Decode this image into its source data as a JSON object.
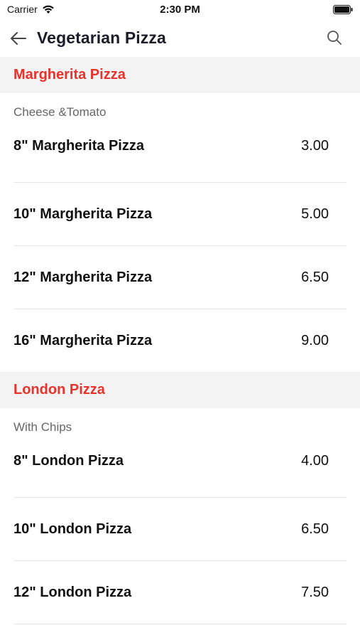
{
  "status": {
    "carrier": "Carrier",
    "time": "2:30 PM"
  },
  "nav": {
    "title": "Vegetarian Pizza"
  },
  "sections": [
    {
      "title": "Margherita Pizza",
      "description": "Cheese &Tomato",
      "items": [
        {
          "name": "8\" Margherita Pizza",
          "price": "3.00"
        },
        {
          "name": "10\" Margherita Pizza",
          "price": "5.00"
        },
        {
          "name": "12\" Margherita Pizza",
          "price": "6.50"
        },
        {
          "name": "16\" Margherita Pizza",
          "price": "9.00"
        }
      ]
    },
    {
      "title": "London Pizza",
      "description": "With Chips",
      "items": [
        {
          "name": "8\" London Pizza",
          "price": "4.00"
        },
        {
          "name": "10\" London Pizza",
          "price": "6.50"
        },
        {
          "name": "12\" London Pizza",
          "price": "7.50"
        }
      ]
    }
  ],
  "colors": {
    "accent": "#e8322c",
    "section_bg": "#f3f3f3",
    "title": "#1c1c2a"
  }
}
